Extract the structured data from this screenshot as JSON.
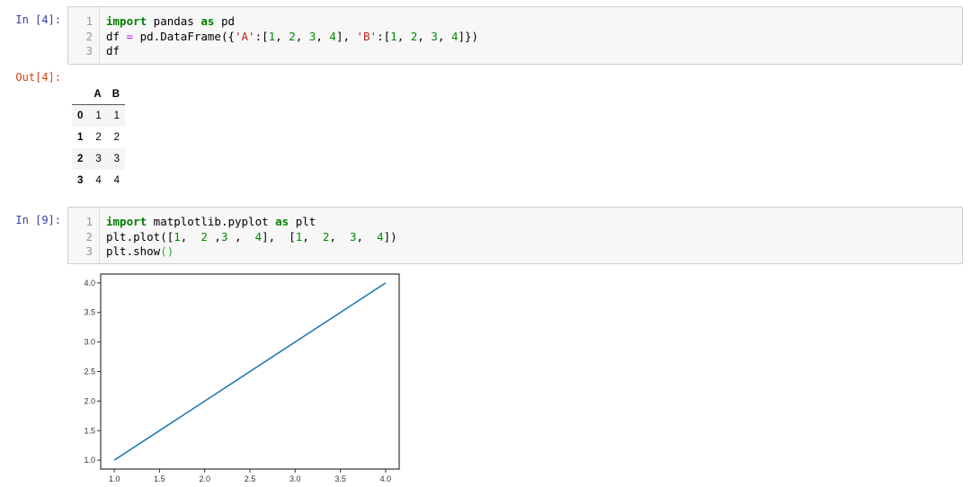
{
  "cells": [
    {
      "in_prompt": "In  [4]:",
      "lines": [
        {
          "n": "1",
          "tokens": [
            [
              "import",
              "kw"
            ],
            [
              " pandas ",
              ""
            ],
            [
              "as",
              "kw"
            ],
            [
              " pd",
              ""
            ]
          ]
        },
        {
          "n": "2",
          "tokens": [
            [
              "df ",
              ""
            ],
            [
              "=",
              "op"
            ],
            [
              " pd.DataFrame({",
              ""
            ],
            [
              "'A'",
              "str"
            ],
            [
              ":[",
              ""
            ],
            [
              "1",
              "num"
            ],
            [
              ", ",
              ""
            ],
            [
              "2",
              "num"
            ],
            [
              ", ",
              ""
            ],
            [
              "3",
              "num"
            ],
            [
              ", ",
              ""
            ],
            [
              "4",
              "num"
            ],
            [
              "], ",
              ""
            ],
            [
              "'B'",
              "str"
            ],
            [
              ":[",
              ""
            ],
            [
              "1",
              "num"
            ],
            [
              ", ",
              ""
            ],
            [
              "2",
              "num"
            ],
            [
              ", ",
              ""
            ],
            [
              "3",
              "num"
            ],
            [
              ", ",
              ""
            ],
            [
              "4",
              "num"
            ],
            [
              "]})",
              ""
            ]
          ]
        },
        {
          "n": "3",
          "tokens": [
            [
              "df",
              ""
            ]
          ]
        }
      ],
      "out_prompt": "Out[4]:",
      "table": {
        "columns": [
          "",
          "A",
          "B"
        ],
        "rows": [
          [
            "0",
            "1",
            "1"
          ],
          [
            "1",
            "2",
            "2"
          ],
          [
            "2",
            "3",
            "3"
          ],
          [
            "3",
            "4",
            "4"
          ]
        ]
      }
    },
    {
      "in_prompt": "In  [9]:",
      "lines": [
        {
          "n": "1",
          "tokens": [
            [
              "import",
              "kw"
            ],
            [
              " matplotlib.pyplot ",
              ""
            ],
            [
              "as",
              "kw"
            ],
            [
              " plt",
              ""
            ]
          ]
        },
        {
          "n": "2",
          "tokens": [
            [
              "plt.plot([",
              ""
            ],
            [
              "1",
              "num"
            ],
            [
              ",  ",
              ""
            ],
            [
              "2",
              "num"
            ],
            [
              " ,",
              ""
            ],
            [
              "3",
              "num"
            ],
            [
              " ,  ",
              ""
            ],
            [
              "4",
              "num"
            ],
            [
              "],  [",
              ""
            ],
            [
              "1",
              "num"
            ],
            [
              ",  ",
              ""
            ],
            [
              "2",
              "num"
            ],
            [
              ",  ",
              ""
            ],
            [
              "3",
              "num"
            ],
            [
              ",  ",
              ""
            ],
            [
              "4",
              "num"
            ],
            [
              "])",
              ""
            ]
          ]
        },
        {
          "n": "3",
          "tokens": [
            [
              "plt.show",
              ""
            ],
            [
              "()",
              "pb"
            ]
          ]
        }
      ]
    }
  ],
  "chart_data": {
    "type": "line",
    "x": [
      1,
      2,
      3,
      4
    ],
    "series": [
      {
        "name": "line",
        "values": [
          1,
          2,
          3,
          4
        ],
        "color": "#1f77b4"
      }
    ],
    "xlim": [
      0.85,
      4.15
    ],
    "ylim": [
      0.85,
      4.15
    ],
    "xticks": [
      "1.0",
      "1.5",
      "2.0",
      "2.5",
      "3.0",
      "3.5",
      "4.0"
    ],
    "yticks": [
      "1.0",
      "1.5",
      "2.0",
      "2.5",
      "3.0",
      "3.5",
      "4.0"
    ],
    "title": "",
    "xlabel": "",
    "ylabel": "",
    "grid": false
  }
}
